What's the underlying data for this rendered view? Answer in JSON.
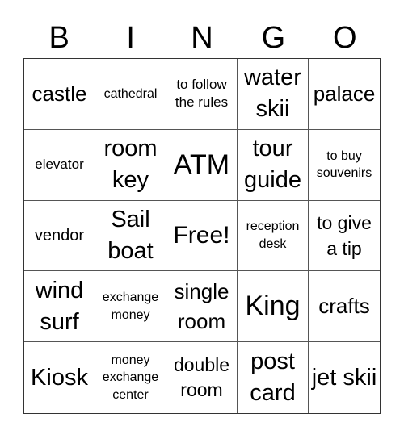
{
  "title_letters": [
    "B",
    "I",
    "N",
    "G",
    "O"
  ],
  "cells": [
    [
      "castle",
      "cathedral",
      "to follow the rules",
      "water skii",
      "palace"
    ],
    [
      "elevator",
      "room key",
      "ATM",
      "tour guide",
      "to buy souvenirs"
    ],
    [
      "vendor",
      "Sail boat",
      "Free!",
      "reception desk",
      "to give a tip"
    ],
    [
      "wind surf",
      "exchange money",
      "single room",
      "King",
      "crafts"
    ],
    [
      "Kiosk",
      "money exchange center",
      "double room",
      "post card",
      "jet skii"
    ]
  ]
}
